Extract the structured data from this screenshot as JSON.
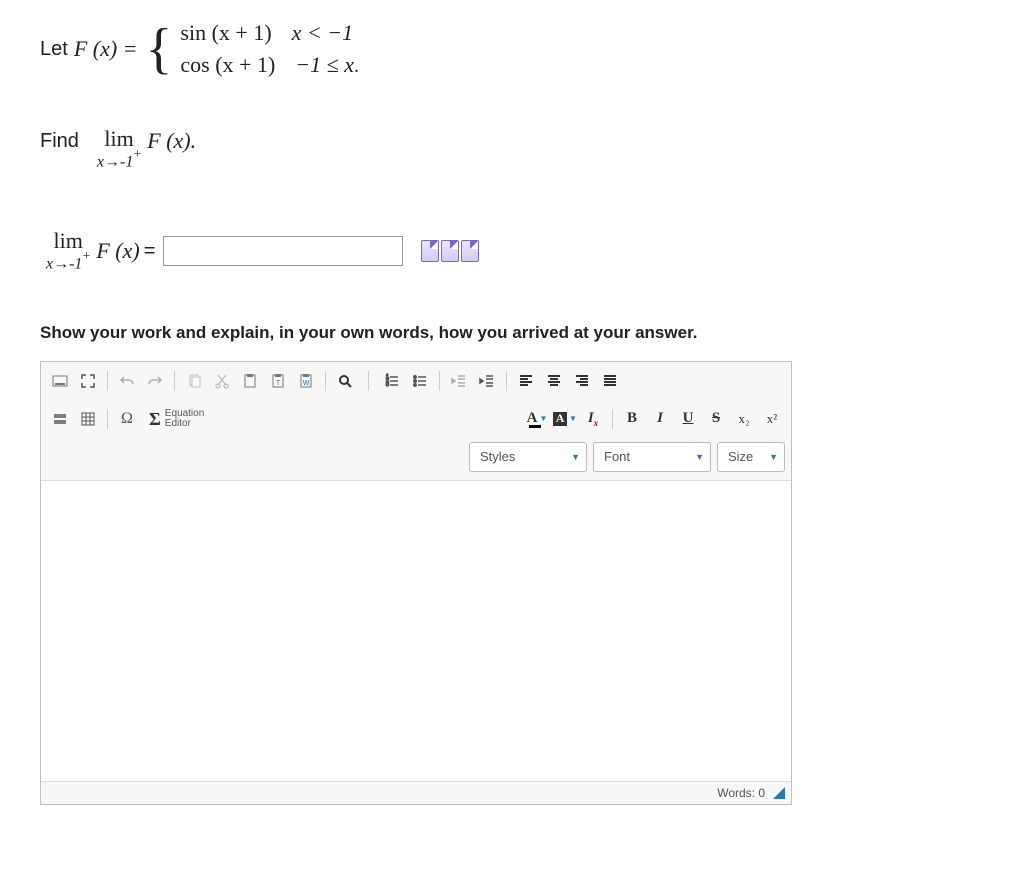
{
  "question": {
    "let_label": "Let ",
    "func": "F (x) = ",
    "piece1_expr": "sin (x + 1)",
    "piece1_cond": "x < −1",
    "piece2_expr": "cos (x + 1)",
    "piece2_cond": "−1 ≤ x",
    "tail": "."
  },
  "find": {
    "label": "Find",
    "lim_text": "lim",
    "lim_under": "x→-1",
    "lim_sup": "+",
    "fx": "F (x).",
    "fx2": "F (x)",
    "equals": " ="
  },
  "answer_value": "",
  "work_label": "Show your work and explain, in your own words, how you arrived at your answer.",
  "toolbar": {
    "equation_editor": "Equation\nEditor",
    "styles": "Styles",
    "font": "Font",
    "size": "Size"
  },
  "format": {
    "A": "A",
    "I": "I",
    "x": "x",
    "B": "B",
    "U": "U",
    "S": "S",
    "sub": "x₂",
    "sup": "x²"
  },
  "list_icons": {
    "ol": "≡",
    "ul": "≡"
  },
  "footer": {
    "words_label": "Words: 0"
  }
}
